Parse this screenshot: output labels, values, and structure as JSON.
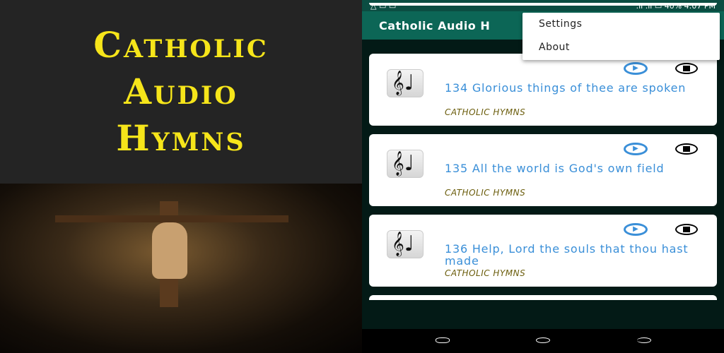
{
  "promo": {
    "title_lines": [
      "Catholic",
      "Audio",
      "Hymns"
    ]
  },
  "status_bar": {
    "battery": "40%",
    "time": "4:07 PM"
  },
  "app_bar": {
    "title": "Catholic Audio H"
  },
  "menu": {
    "items": [
      "Settings",
      "About"
    ]
  },
  "hymns": [
    {
      "title": "134 Glorious things of thee are spoken",
      "category": "CATHOLIC HYMNS"
    },
    {
      "title": "135 All the world is God's own field",
      "category": "CATHOLIC HYMNS"
    },
    {
      "title": "136 Help, Lord the souls that thou hast made",
      "category": "CATHOLIC HYMNS"
    }
  ],
  "colors": {
    "accent": "#3a8fd8",
    "app_bar": "#0c6656",
    "title_yellow": "#f6e51a"
  }
}
